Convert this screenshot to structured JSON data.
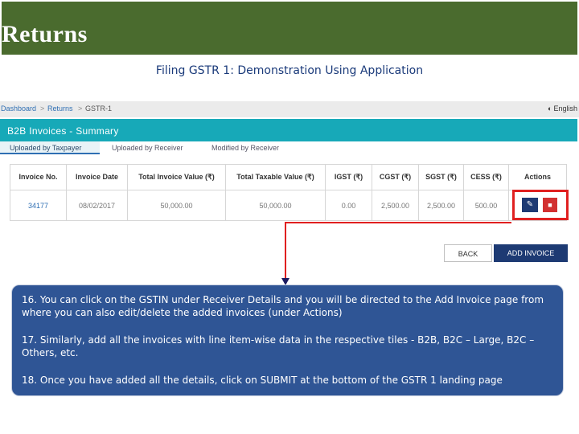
{
  "slide": {
    "title": "Returns",
    "subtitle": "Filing GSTR 1: Demonstration Using Application"
  },
  "breadcrumb": {
    "items": [
      "Dashboard",
      "Returns",
      "GSTR-1"
    ],
    "separator": ">"
  },
  "language": {
    "icon": "globe-icon",
    "label": "English"
  },
  "summary": {
    "title": "B2B Invoices - Summary"
  },
  "tabs": [
    {
      "label": "Uploaded by Taxpayer",
      "active": true
    },
    {
      "label": "Uploaded by Receiver",
      "active": false
    },
    {
      "label": "Modified by Receiver",
      "active": false
    }
  ],
  "table": {
    "headers": [
      "Invoice No.",
      "Invoice Date",
      "Total Invoice Value (₹)",
      "Total Taxable Value (₹)",
      "IGST (₹)",
      "CGST (₹)",
      "SGST (₹)",
      "CESS (₹)",
      "Actions"
    ],
    "rows": [
      [
        "34177",
        "08/02/2017",
        "50,000.00",
        "50,000.00",
        "0.00",
        "2,500.00",
        "2,500.00",
        "500.00"
      ]
    ]
  },
  "actions": {
    "edit_icon": "pencil-icon",
    "delete_icon": "trash-icon",
    "edit_glyph": "✎",
    "delete_glyph": "■"
  },
  "buttons": {
    "back": "BACK",
    "add_invoice": "ADD INVOICE"
  },
  "colors": {
    "header_green": "#4a6b2e",
    "teal": "#17a9b8",
    "navy": "#1d3a73",
    "highlight_red": "#e02020",
    "info_blue": "#2f5595"
  },
  "notes": [
    "16. You can click on the GSTIN under Receiver Details and you will be directed to the Add Invoice page from where you can also edit/delete the added invoices (under Actions)",
    "17. Similarly, add all the invoices with line item-wise data in the respective tiles - B2B, B2C – Large, B2C – Others, etc.",
    "18. Once you have added all the details, click on SUBMIT at the bottom of the GSTR 1 landing page"
  ]
}
